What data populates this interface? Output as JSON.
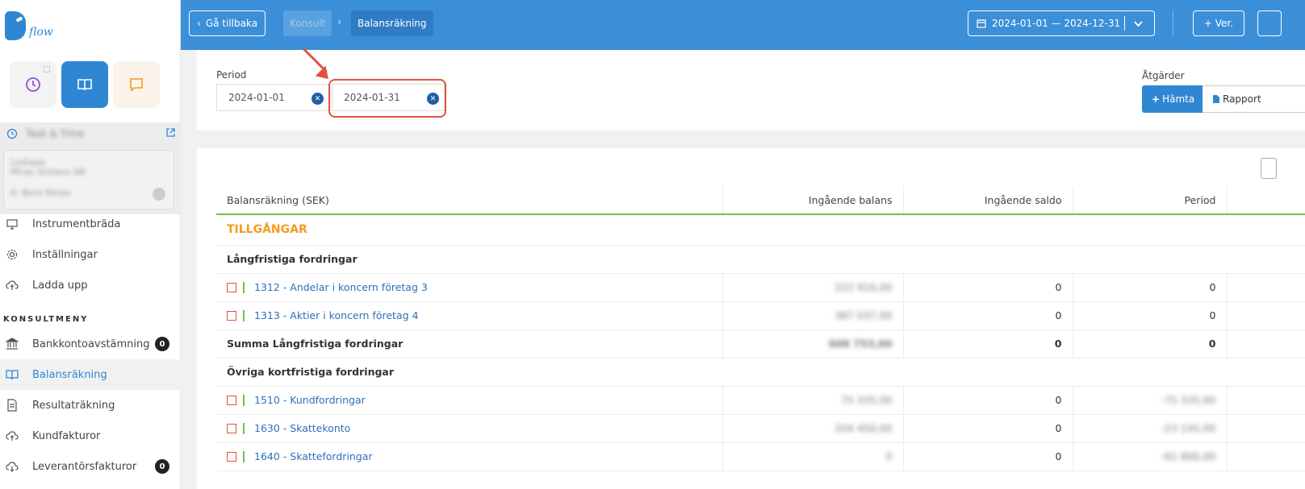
{
  "brand": {
    "word": "flow"
  },
  "sidebar": {
    "track": {
      "title": "Task & Time",
      "card_line1": "Lediaaa",
      "card_line2": "Miras Sintace AB",
      "card_line3": "0: Bont Ritiae"
    },
    "nav_top": [
      {
        "label": "Instrumentbräda",
        "icon": "monitor-icon"
      },
      {
        "label": "Inställningar",
        "icon": "gear-icon"
      },
      {
        "label": "Ladda upp",
        "icon": "upload-cloud-icon"
      }
    ],
    "section_title": "KONSULTMENY",
    "nav_consult": [
      {
        "label": "Bankkontoavstämning",
        "icon": "bank-icon",
        "badge": "0"
      },
      {
        "label": "Balansräkning",
        "icon": "book-icon",
        "active": true
      },
      {
        "label": "Resultaträkning",
        "icon": "document-icon"
      },
      {
        "label": "Kundfakturor",
        "icon": "upload-cloud-icon"
      },
      {
        "label": "Leverantörsfakturor",
        "icon": "download-cloud-icon",
        "badge": "0"
      }
    ]
  },
  "header": {
    "back_label": "Gå tillbaka",
    "crumbs": [
      "Konsult",
      "Balansräkning"
    ],
    "date_range": "2024-01-01 — 2024-12-31",
    "ver_label": "+ Ver."
  },
  "filters": {
    "period_label": "Period",
    "from": "2024-01-01",
    "to": "2024-01-31",
    "actions_label": "Åtgärder",
    "fetch_label": "Hämta",
    "report_label": "Rapport"
  },
  "table": {
    "headers": [
      "Balansräkning (SEK)",
      "Ingående balans",
      "Ingående saldo",
      "Period"
    ],
    "section": "TILLGÅNGAR",
    "group1": "Långfristiga fordringar",
    "rows1": [
      {
        "label": "1312 - Andelar i koncern företag 3",
        "balans": "222 916,00",
        "saldo": "0",
        "period": "0"
      },
      {
        "label": "1313 - Aktier i koncern företag 4",
        "balans": "387 037,00",
        "saldo": "0",
        "period": "0"
      }
    ],
    "sum1": {
      "label": "Summa Långfristiga fordringar",
      "balans": "608 753,00",
      "saldo": "0",
      "period": "0"
    },
    "group2": "Övriga kortfristiga fordringar",
    "rows2": [
      {
        "label": "1510 - Kundfordringar",
        "balans": "75 335,00",
        "saldo": "0",
        "period": "-75 335,00"
      },
      {
        "label": "1630 - Skattekonto",
        "balans": "204 450,00",
        "saldo": "0",
        "period": "-23 145,00"
      },
      {
        "label": "1640 - Skattefordringar",
        "balans": "0",
        "saldo": "0",
        "period": "-61 800,00"
      }
    ]
  },
  "colors": {
    "primary": "#3b8fd9",
    "accent": "#f29b1f",
    "annotation": "#e0533e",
    "divider": "#6cc14d"
  }
}
